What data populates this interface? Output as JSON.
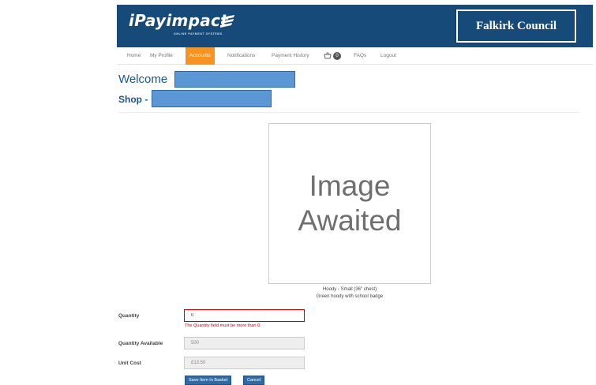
{
  "header": {
    "logo_text": "iPayimpact",
    "logo_tagline": "ONLINE PAYMENT SYSTEMS",
    "council_name": "Falkirk Council"
  },
  "nav": {
    "items": [
      {
        "label": "Home"
      },
      {
        "label": "My Profile"
      },
      {
        "label": "Accounts"
      },
      {
        "label": "Notifications"
      },
      {
        "label": "Payment History"
      },
      {
        "label": "FAQs"
      },
      {
        "label": "Logout"
      }
    ],
    "active": "Accounts",
    "basket_icon": "basket-icon",
    "basket_count": "0"
  },
  "main": {
    "welcome_label": "Welcome",
    "shop_label": "Shop -"
  },
  "product": {
    "image_text": "Image Awaited",
    "name": "Hoody - Small (36\" chest)",
    "description": "Green hoody with school badge"
  },
  "form": {
    "quantity_label": "Quantity",
    "quantity_value": "0",
    "quantity_error": "The Quantity field must be more than 0.",
    "available_label": "Quantity Available",
    "available_value": "500",
    "unit_cost_label": "Unit Cost",
    "unit_cost_value": "£13.50",
    "save_button": "Save Item In Basket",
    "cancel_button": "Cancel"
  },
  "colors": {
    "banner": "#164b79",
    "nav_active": "#f7931e",
    "heading": "#1c5890",
    "error": "#cc0000",
    "button": "#2e6aa3"
  }
}
